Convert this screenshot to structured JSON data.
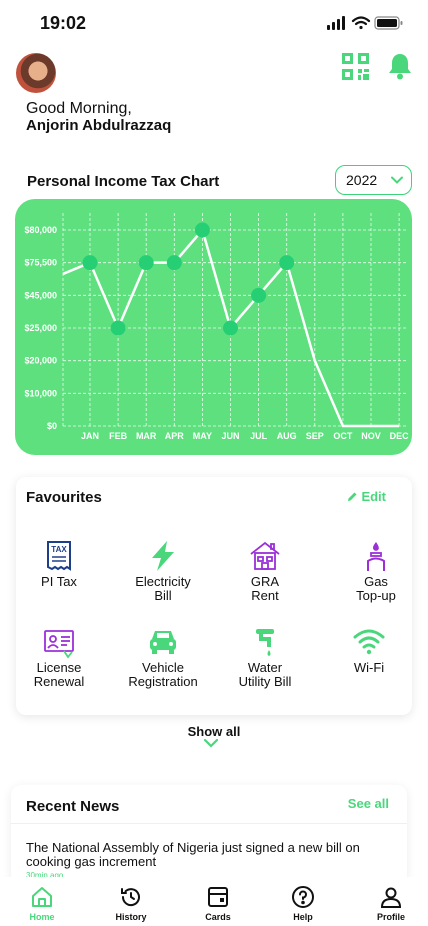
{
  "status": {
    "time": "19:02"
  },
  "header": {
    "greeting": "Good Morning,",
    "name": "Anjorin Abdulrazzaq"
  },
  "chart": {
    "title": "Personal Income Tax Chart",
    "year": "2022"
  },
  "chart_data": {
    "type": "line",
    "title": "Personal Income Tax Chart",
    "categories": [
      "JAN",
      "FEB",
      "MAR",
      "APR",
      "MAY",
      "JUN",
      "JUL",
      "AUG",
      "SEP",
      "OCT",
      "NOV",
      "DEC"
    ],
    "ytick_labels": [
      "$0",
      "$10,000",
      "$20,000",
      "$25,000",
      "$45,000",
      "$75,500",
      "$80,000"
    ],
    "series": [
      {
        "values": [
          75500,
          25000,
          75500,
          75500,
          80000,
          25000,
          45000,
          75500,
          20000,
          0,
          0,
          0
        ]
      }
    ],
    "line_start_value": 65000,
    "marked_points": 8,
    "grid": true,
    "colors": {
      "background": "#5ee07f",
      "line": "#ffffff",
      "marker": "#26cf74",
      "grid": "#ffffff"
    }
  },
  "favourites": {
    "title": "Favourites",
    "edit_label": "Edit",
    "items": [
      {
        "label": "PI Tax",
        "icon": "tax-receipt-icon"
      },
      {
        "label": "Electricity\nBill",
        "icon": "lightning-icon"
      },
      {
        "label": "GRA\nRent",
        "icon": "house-icon"
      },
      {
        "label": "Gas\nTop-up",
        "icon": "gas-burner-icon"
      },
      {
        "label": "License\nRenewal",
        "icon": "id-card-icon"
      },
      {
        "label": "Vehicle\nRegistration",
        "icon": "car-icon"
      },
      {
        "label": "Water\nUtility Bill",
        "icon": "water-tap-icon"
      },
      {
        "label": "Wi-Fi",
        "icon": "wifi-icon"
      }
    ],
    "show_all_label": "Show all"
  },
  "news": {
    "title": "Recent News",
    "see_all_label": "See all",
    "items": [
      {
        "text": "The National Assembly of Nigeria just signed a new bill on cooking gas increment",
        "time": "30min ago"
      }
    ]
  },
  "nav": {
    "items": [
      {
        "label": "Home",
        "icon": "home-icon",
        "active": true
      },
      {
        "label": "History",
        "icon": "history-icon",
        "active": false
      },
      {
        "label": "Cards",
        "icon": "cards-icon",
        "active": false
      },
      {
        "label": "Help",
        "icon": "help-icon",
        "active": false
      },
      {
        "label": "Profile",
        "icon": "profile-icon",
        "active": false
      }
    ]
  },
  "colors": {
    "accent": "#4ad77c",
    "chart_bg": "#5ee07f",
    "purple": "#9b30d9",
    "navy": "#1d3f8a"
  }
}
